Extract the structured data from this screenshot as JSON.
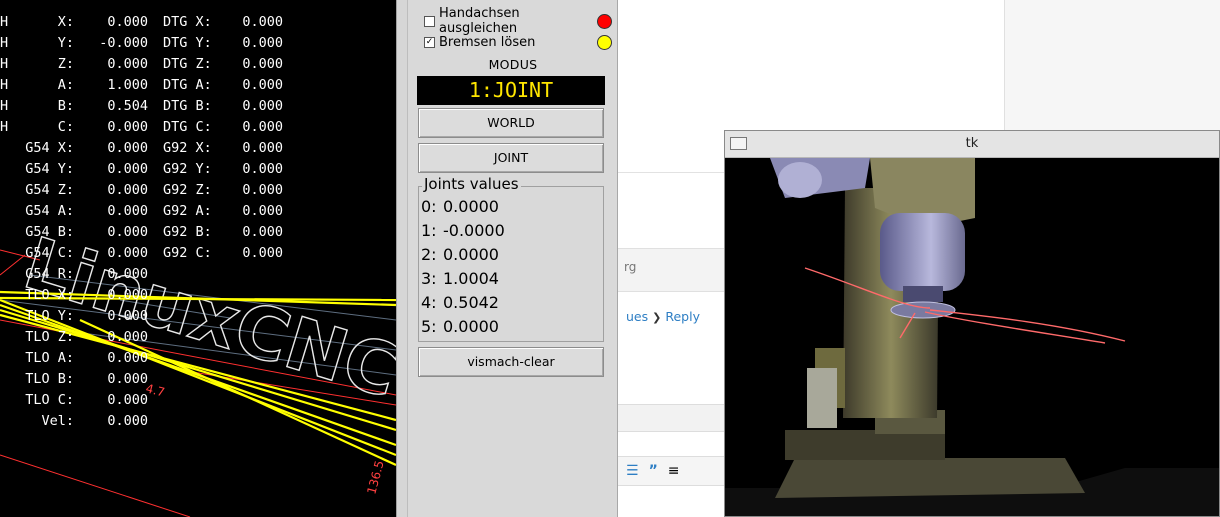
{
  "dro": {
    "rows": [
      {
        "prefix": "H",
        "label": "X:",
        "value": "0.000",
        "dtg_label": "DTG X:",
        "dtg_value": "0.000"
      },
      {
        "prefix": "H",
        "label": "Y:",
        "value": "-0.000",
        "dtg_label": "DTG Y:",
        "dtg_value": "0.000"
      },
      {
        "prefix": "H",
        "label": "Z:",
        "value": "0.000",
        "dtg_label": "DTG Z:",
        "dtg_value": "0.000"
      },
      {
        "prefix": "H",
        "label": "A:",
        "value": "1.000",
        "dtg_label": "DTG A:",
        "dtg_value": "0.000"
      },
      {
        "prefix": "H",
        "label": "B:",
        "value": "0.504",
        "dtg_label": "DTG B:",
        "dtg_value": "0.000"
      },
      {
        "prefix": "H",
        "label": "C:",
        "value": "0.000",
        "dtg_label": "DTG C:",
        "dtg_value": "0.000"
      },
      {
        "prefix": "",
        "label": "G54 X:",
        "value": "0.000",
        "dtg_label": "G92 X:",
        "dtg_value": "0.000"
      },
      {
        "prefix": "",
        "label": "G54 Y:",
        "value": "0.000",
        "dtg_label": "G92 Y:",
        "dtg_value": "0.000"
      },
      {
        "prefix": "",
        "label": "G54 Z:",
        "value": "0.000",
        "dtg_label": "G92 Z:",
        "dtg_value": "0.000"
      },
      {
        "prefix": "",
        "label": "G54 A:",
        "value": "0.000",
        "dtg_label": "G92 A:",
        "dtg_value": "0.000"
      },
      {
        "prefix": "",
        "label": "G54 B:",
        "value": "0.000",
        "dtg_label": "G92 B:",
        "dtg_value": "0.000"
      },
      {
        "prefix": "",
        "label": "G54 C:",
        "value": "0.000",
        "dtg_label": "G92 C:",
        "dtg_value": "0.000"
      },
      {
        "prefix": "",
        "label": "G54 R:",
        "value": "0.000",
        "dtg_label": "",
        "dtg_value": ""
      },
      {
        "prefix": "",
        "label": "TLO X:",
        "value": "0.000",
        "dtg_label": "",
        "dtg_value": ""
      },
      {
        "prefix": "",
        "label": "TLO Y:",
        "value": "0.000",
        "dtg_label": "",
        "dtg_value": ""
      },
      {
        "prefix": "",
        "label": "TLO Z:",
        "value": "0.000",
        "dtg_label": "",
        "dtg_value": ""
      },
      {
        "prefix": "",
        "label": "TLO A:",
        "value": "0.000",
        "dtg_label": "",
        "dtg_value": ""
      },
      {
        "prefix": "",
        "label": "TLO B:",
        "value": "0.000",
        "dtg_label": "",
        "dtg_value": ""
      },
      {
        "prefix": "",
        "label": "TLO C:",
        "value": "0.000",
        "dtg_label": "",
        "dtg_value": ""
      },
      {
        "prefix": "",
        "label": "Vel:",
        "value": "0.000",
        "dtg_label": "",
        "dtg_value": ""
      }
    ],
    "preview": {
      "logo_text": "LinuxCNC",
      "dim_a": "4.7",
      "dim_b": "136.5",
      "colors": {
        "toolpath": "#ffff00",
        "limits": "#ff3030",
        "grid": "#6a7a8a"
      }
    }
  },
  "controls": {
    "checkboxes": [
      {
        "label": "Handachsen ausgleichen",
        "checked": false,
        "mark": "",
        "led_color": "#ff0000"
      },
      {
        "label": "Bremsen lösen",
        "checked": true,
        "mark": "✓",
        "led_color": "#ffff00"
      }
    ],
    "modus_title": "MODUS",
    "modus_display": "1:JOINT",
    "world_button": "WORLD",
    "joint_button": "JOINT",
    "joints_title": "Joints values",
    "joints": [
      {
        "key": "0:",
        "value": "0.0000"
      },
      {
        "key": "1:",
        "value": "-0.0000"
      },
      {
        "key": "2:",
        "value": "0.0000"
      },
      {
        "key": "3:",
        "value": "1.0004"
      },
      {
        "key": "4:",
        "value": "0.5042"
      },
      {
        "key": "5:",
        "value": "0.0000"
      }
    ],
    "clear_button": "vismach-clear"
  },
  "background": {
    "fragment_text": "rg",
    "link_prev": "ues",
    "link_sep_icon": "chevron-right-icon",
    "link_reply": "Reply",
    "toolbar_list_icon": "☰",
    "toolbar_quote": "”",
    "toolbar_align_icon": "≡"
  },
  "tk_window": {
    "title": "tk"
  }
}
